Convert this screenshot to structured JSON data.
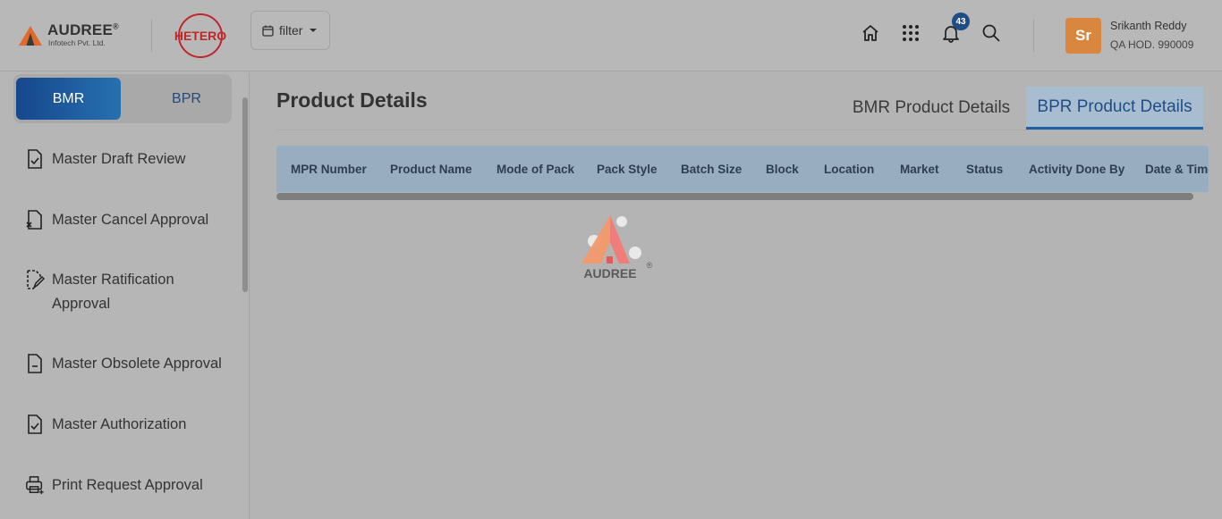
{
  "header": {
    "brand_name": "AUDREE",
    "brand_reg": "®",
    "brand_sub": "Infotech Pvt. Ltd.",
    "client_logo_text": "HETERO",
    "filter_label": "filter",
    "notification_count": "43",
    "icons": [
      "home-icon",
      "apps-grid-icon",
      "bell-icon",
      "search-icon",
      "calendar-icon"
    ],
    "user": {
      "initials": "Sr",
      "name": "Srikanth Reddy",
      "role": "QA HOD. 990009"
    },
    "colors": {
      "badge": "#1f4c82",
      "avatar": "#d9873f",
      "hetero_red": "#c0272d"
    }
  },
  "sidebar": {
    "toggle": {
      "active": "BMR",
      "inactive": "BPR"
    },
    "items": [
      {
        "label": "Master Draft Review",
        "icon": "document-check-icon"
      },
      {
        "label": "Master Cancel Approval",
        "icon": "document-cancel-icon"
      },
      {
        "label": "Master Ratification Approval",
        "icon": "document-edit-icon"
      },
      {
        "label": "Master Obsolete Approval",
        "icon": "document-minus-icon"
      },
      {
        "label": "Master Authorization",
        "icon": "document-check-icon"
      },
      {
        "label": "Print Request Approval",
        "icon": "printer-icon"
      }
    ]
  },
  "main": {
    "title": "Product Details",
    "tabs": [
      {
        "label": "BMR Product Details",
        "active": false
      },
      {
        "label": "BPR Product Details",
        "active": true
      }
    ],
    "table": {
      "columns": [
        "MPR Number",
        "Product Name",
        "Mode of Pack",
        "Pack Style",
        "Batch Size",
        "Block",
        "Location",
        "Market",
        "Status",
        "Activity Done By",
        "Date & Time"
      ],
      "rows": []
    },
    "loader": {
      "text": "AUDREE",
      "reg": "®"
    }
  }
}
